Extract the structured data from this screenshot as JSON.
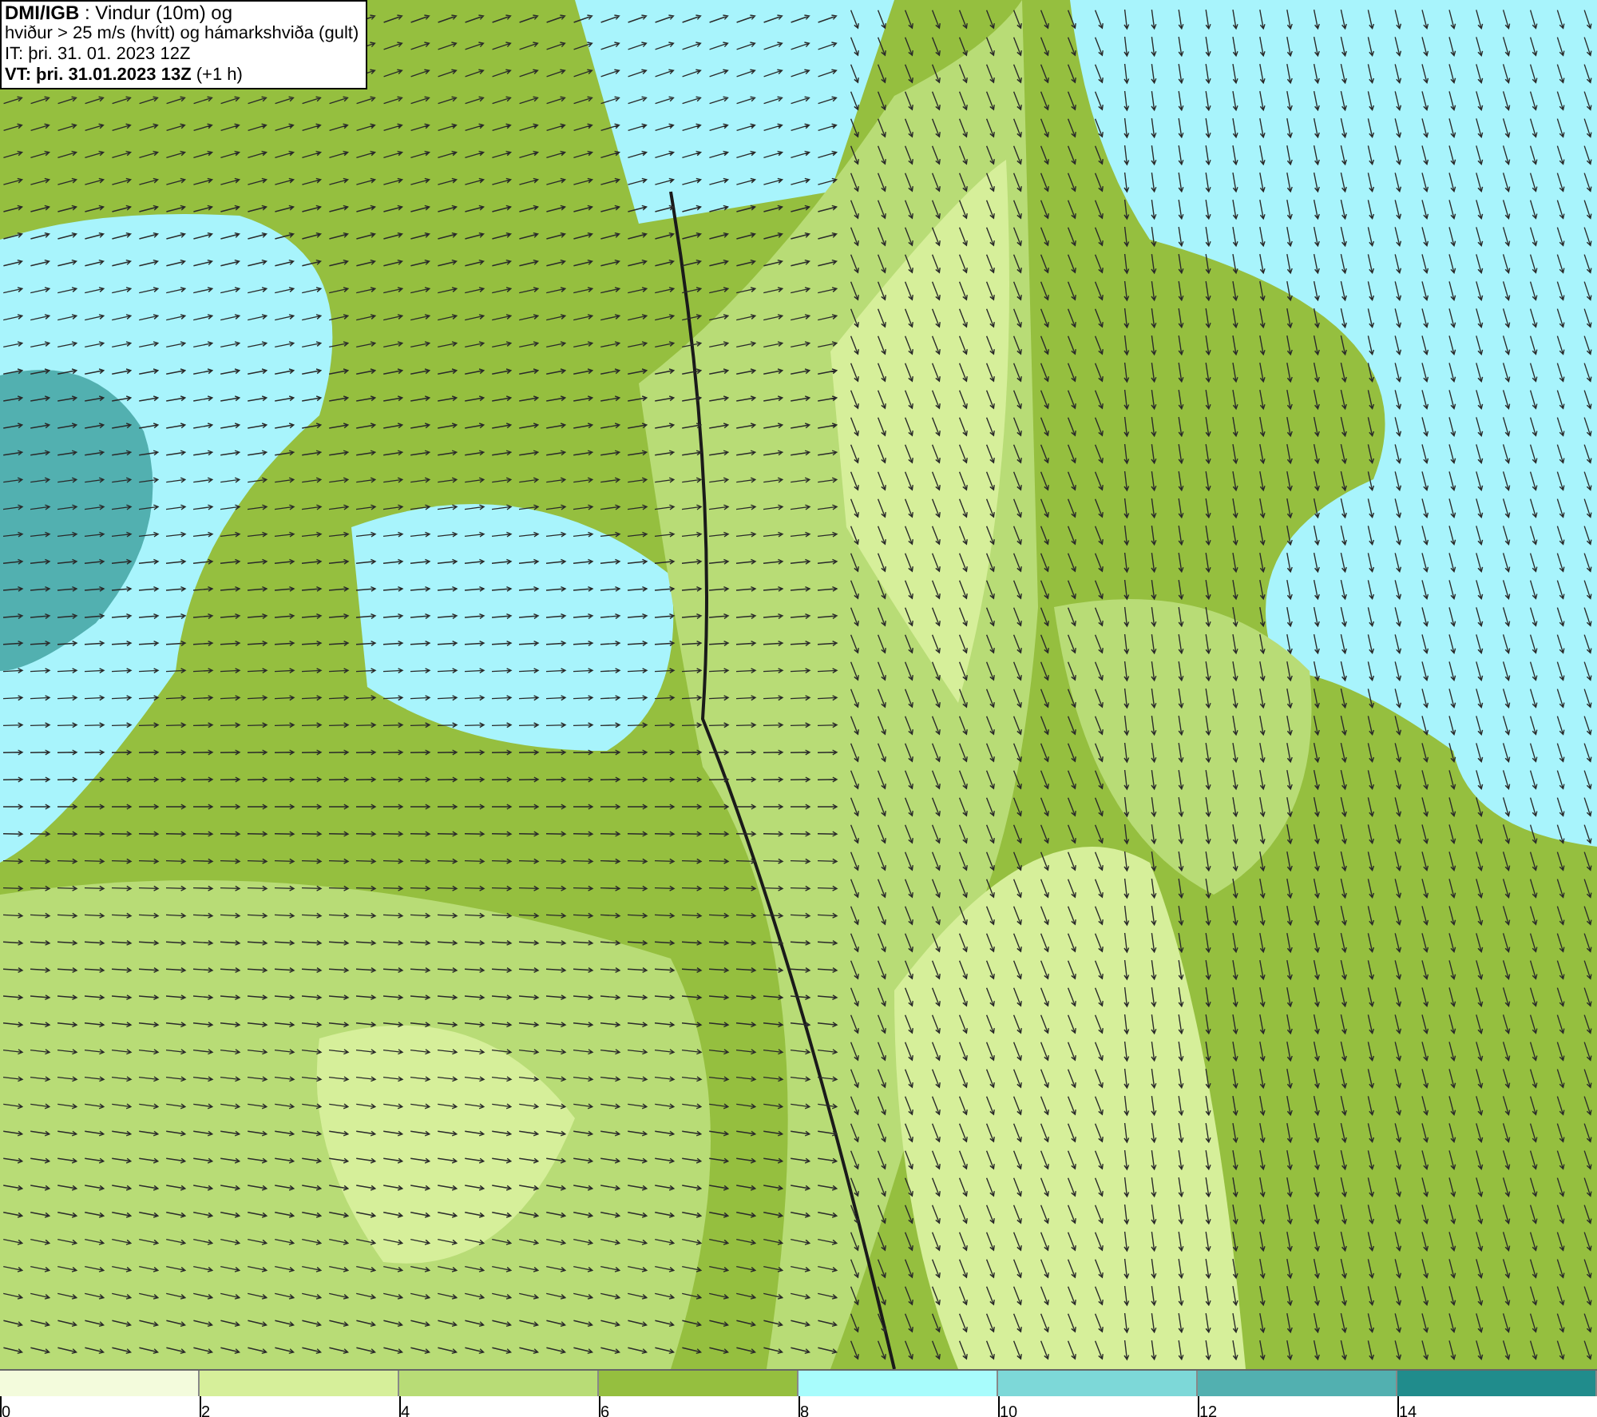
{
  "legend_box": {
    "lines": [
      "**DMI/IGB** : Vindur (10m) og",
      "hviður > 25 m/s (hvítt) og hámarkshviða (gult)",
      "IT: þri. 31. 01. 2023 12Z",
      "**VT: þri. 31.01.2023 13Z** (+1 h)"
    ]
  },
  "colorbar": {
    "segments": [
      {
        "color": "#f3fbdc"
      },
      {
        "color": "#d6ef9a"
      },
      {
        "color": "#b8dc76"
      },
      {
        "color": "#95bf3f"
      },
      {
        "color": "#a8fcfc"
      },
      {
        "color": "#7dd8d8"
      },
      {
        "color": "#52b0b0"
      },
      {
        "color": "#208c8c"
      }
    ],
    "ticks": [
      "0",
      "2",
      "4",
      "6",
      "8",
      "10",
      "12",
      "14"
    ]
  }
}
